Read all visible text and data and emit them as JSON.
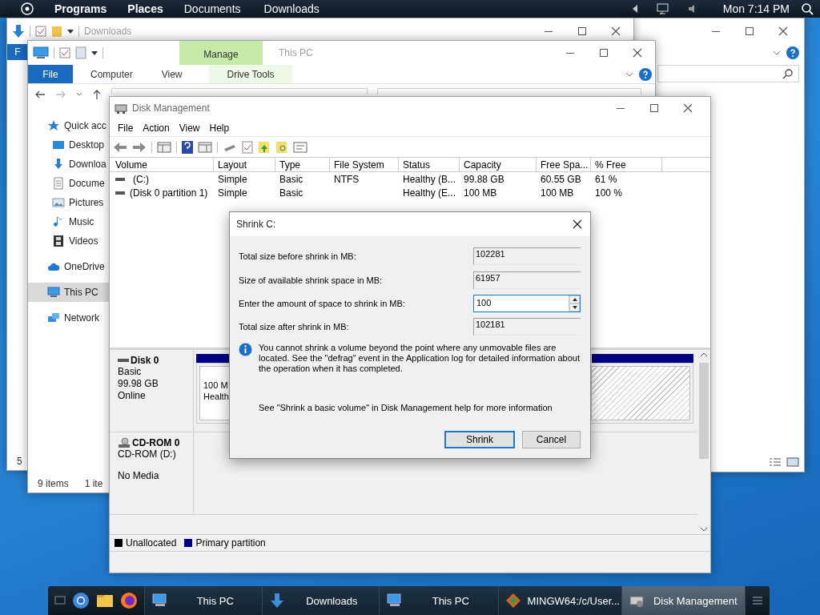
{
  "top_bar": {
    "menu": [
      "Programs",
      "Places",
      "Documents",
      "Downloads"
    ],
    "clock": "Mon 7:14 PM"
  },
  "downloads_window": {
    "title": "Downloads",
    "ribbon_tab": "F",
    "status": "5"
  },
  "this_pc_window": {
    "title": "This PC",
    "context_tab": "Manage",
    "tabs": [
      {
        "label": "File",
        "kind": "file"
      },
      {
        "label": "Computer",
        "kind": "plain"
      },
      {
        "label": "View",
        "kind": "plain"
      },
      {
        "label": "Drive Tools",
        "kind": "context"
      }
    ],
    "nav": [
      {
        "label": "Quick acc",
        "kind": "star",
        "selected": false
      },
      {
        "label": "Desktop",
        "kind": "desktop",
        "selected": false
      },
      {
        "label": "Downloa",
        "kind": "download",
        "selected": false
      },
      {
        "label": "Docume",
        "kind": "document",
        "selected": false
      },
      {
        "label": "Pictures",
        "kind": "pictures",
        "selected": false
      },
      {
        "label": "Music",
        "kind": "music",
        "selected": false
      },
      {
        "label": "Videos",
        "kind": "video",
        "selected": false
      },
      {
        "label": "OneDrive",
        "kind": "cloud",
        "selected": false
      },
      {
        "label": "This PC",
        "kind": "pc",
        "selected": true
      },
      {
        "label": "Network",
        "kind": "network",
        "selected": false
      }
    ],
    "status": [
      "9 items",
      "1 ite"
    ]
  },
  "disk_management": {
    "title": "Disk Management",
    "menu": [
      "File",
      "Action",
      "View",
      "Help"
    ],
    "columns": [
      "Volume",
      "Layout",
      "Type",
      "File System",
      "Status",
      "Capacity",
      "Free Spa...",
      "% Free"
    ],
    "rows": [
      [
        "(C:)",
        "Simple",
        "Basic",
        "NTFS",
        "Healthy (B...",
        "99.88 GB",
        "60.55 GB",
        "61 %"
      ],
      [
        "(Disk 0 partition 1)",
        "Simple",
        "Basic",
        "",
        "Healthy (E...",
        "100 MB",
        "100 MB",
        "100 %"
      ]
    ],
    "disks": [
      {
        "name": "Disk 0",
        "kind": "disk",
        "lines": [
          "Basic",
          "99.98 GB",
          "Online"
        ]
      },
      {
        "name": "CD-ROM 0",
        "kind": "cdrom",
        "lines": [
          "CD-ROM (D:)",
          "No Media"
        ]
      }
    ],
    "partition": {
      "size": "100 M",
      "status": "Health"
    },
    "legend": [
      {
        "label": "Unallocated",
        "color": "#000000"
      },
      {
        "label": "Primary partition",
        "color": "#000080"
      }
    ]
  },
  "dialog": {
    "title": "Shrink C:",
    "fields": [
      {
        "label": "Total size before shrink in MB:",
        "value": "102281",
        "kind": "readonly"
      },
      {
        "label": "Size of available shrink space in MB:",
        "value": "61957",
        "kind": "readonly"
      },
      {
        "label": "Enter the amount of space to shrink in MB:",
        "value": "100",
        "kind": "spin"
      },
      {
        "label": "Total size after shrink in MB:",
        "value": "102181",
        "kind": "readonly"
      }
    ],
    "info": "You cannot shrink a volume beyond the point where any unmovable files are located. See the \"defrag\" event in the Application log for detailed information about the operation when it has completed.",
    "help": "See \"Shrink a basic volume\" in Disk Management help for more information",
    "buttons": [
      {
        "label": "Shrink",
        "kind": "default"
      },
      {
        "label": "Cancel",
        "kind": "normal"
      }
    ]
  },
  "taskbar": {
    "items": [
      {
        "label": "This PC",
        "kind": "pc",
        "selected": false
      },
      {
        "label": "Downloads",
        "kind": "download",
        "selected": false
      },
      {
        "label": "This PC",
        "kind": "pc",
        "selected": false
      },
      {
        "label": "MINGW64:/c/User...",
        "kind": "git",
        "selected": false
      },
      {
        "label": "Disk Management",
        "kind": "disk",
        "selected": true
      }
    ]
  }
}
